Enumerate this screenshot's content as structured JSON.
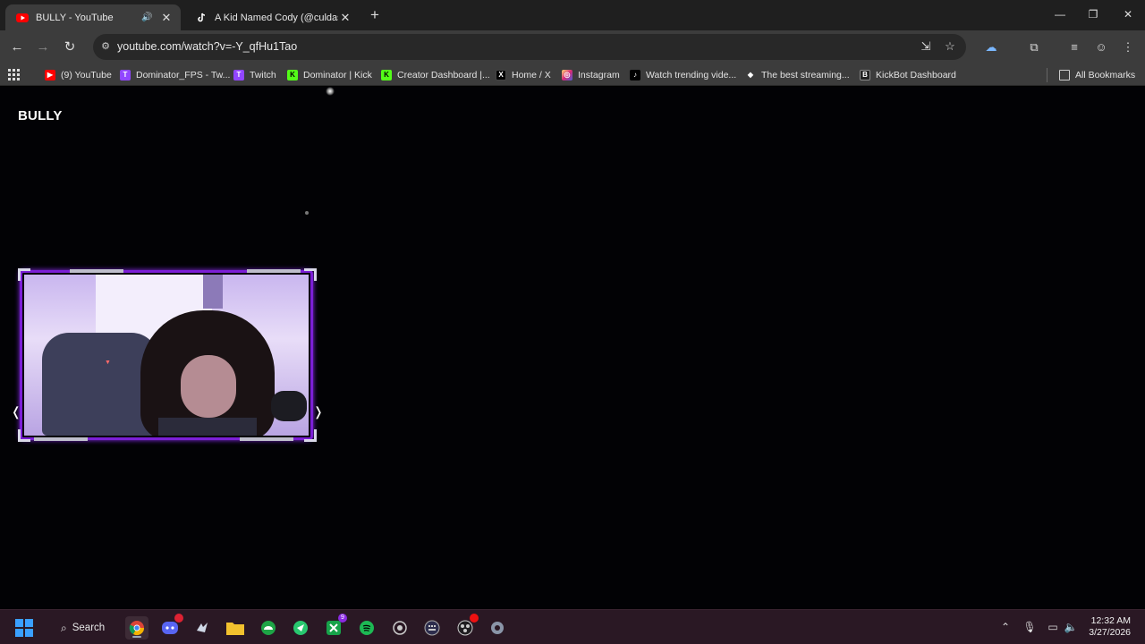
{
  "browser": {
    "tabs": [
      {
        "title": "BULLY - YouTube",
        "icon": "youtube-icon",
        "active": true,
        "audio": true
      },
      {
        "title": "A Kid Named Cody (@culdasac",
        "icon": "tiktok-icon",
        "active": false
      }
    ],
    "new_tab_label": "+",
    "window_controls": {
      "minimize": "—",
      "restore": "❐",
      "close": "✕"
    }
  },
  "toolbar": {
    "back": "←",
    "forward": "→",
    "reload": "↻",
    "url": "youtube.com/watch?v=-Y_qfHu1Tao"
  },
  "bookmarks": [
    {
      "label": "(9) YouTube",
      "icon": "youtube-icon",
      "color": "#ff0000",
      "glyph": "▶"
    },
    {
      "label": "Dominator_FPS - Tw...",
      "icon": "twitch-icon",
      "color": "#9146ff",
      "glyph": "T"
    },
    {
      "label": "Twitch",
      "icon": "twitch-icon",
      "color": "#9146ff",
      "glyph": "T"
    },
    {
      "label": "Dominator | Kick",
      "icon": "kick-icon",
      "color": "#53fc18",
      "glyph": "K"
    },
    {
      "label": "Creator Dashboard |...",
      "icon": "kick-icon",
      "color": "#53fc18",
      "glyph": "K"
    },
    {
      "label": "Home / X",
      "icon": "x-icon",
      "color": "#000000",
      "glyph": "X"
    },
    {
      "label": "Instagram",
      "icon": "instagram-icon",
      "color": "#d62976",
      "glyph": "◎"
    },
    {
      "label": "Watch trending vide...",
      "icon": "tiktok-icon",
      "color": "#000000",
      "glyph": "♪"
    },
    {
      "label": "The best streaming...",
      "icon": "streaming-icon",
      "color": "#ffffff",
      "glyph": "◆"
    },
    {
      "label": "KickBot Dashboard",
      "icon": "kickbot-icon",
      "color": "#222222",
      "glyph": "B"
    }
  ],
  "all_bookmarks_label": "All Bookmarks",
  "page": {
    "video_title": "BULLY"
  },
  "taskbar": {
    "search_label": "Search",
    "apps": [
      {
        "name": "chrome-icon",
        "glyph": "◉",
        "color": "#4285f4",
        "active": true
      },
      {
        "name": "discord-icon",
        "glyph": "☺",
        "color": "#5865f2",
        "badge": ""
      },
      {
        "name": "steam-icon",
        "glyph": "⚙",
        "color": "#1b2838"
      },
      {
        "name": "file-explorer-icon",
        "glyph": "▭",
        "color": "#f2c12e"
      },
      {
        "name": "obs-icon",
        "glyph": "◍",
        "color": "#22b14c"
      },
      {
        "name": "app-green-icon",
        "glyph": "➤",
        "color": "#22c55e"
      },
      {
        "name": "xbox-icon",
        "glyph": "✕",
        "color": "#107c10",
        "badge": "9"
      },
      {
        "name": "spotify-icon",
        "glyph": "≋",
        "color": "#1db954"
      },
      {
        "name": "media-icon",
        "glyph": "◎",
        "color": "#444466"
      },
      {
        "name": "keyboard-icon",
        "glyph": "▦",
        "color": "#333355"
      },
      {
        "name": "obs-studio-icon",
        "glyph": "◐",
        "color": "#302e31",
        "badge": ""
      },
      {
        "name": "settings-icon",
        "glyph": "⚙",
        "color": "#4a4a5a"
      }
    ],
    "clock_time": "12:32 AM",
    "clock_date": "3/27/2026"
  }
}
